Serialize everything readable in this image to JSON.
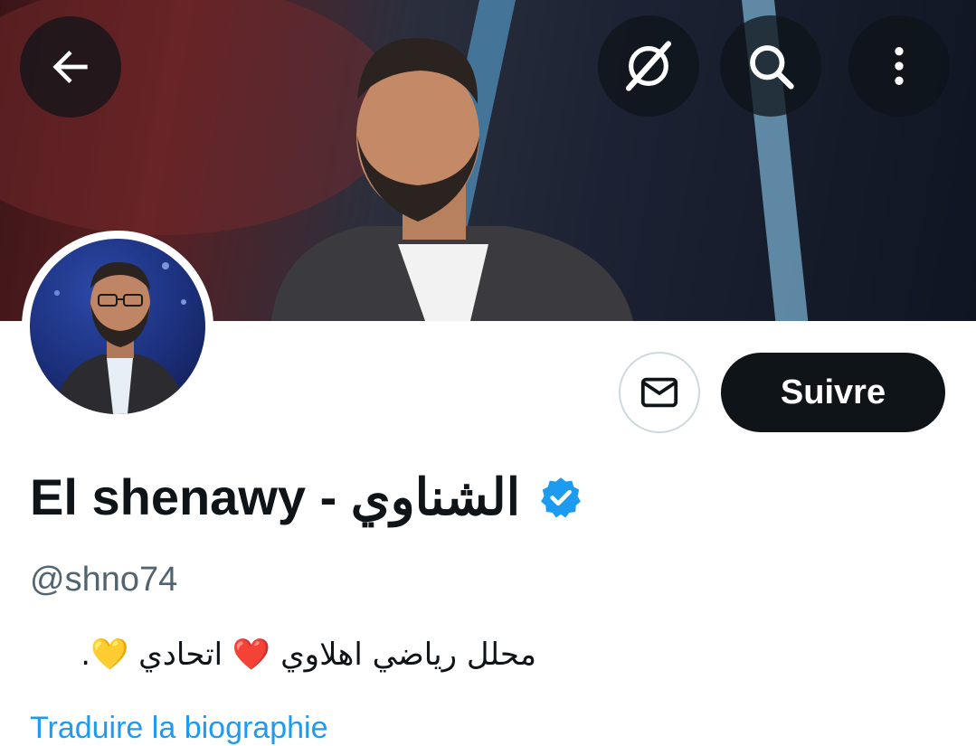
{
  "header": {
    "back_icon": "arrow-left-icon",
    "grok_icon": "grok-icon",
    "search_icon": "search-icon",
    "more_icon": "more-vertical-icon"
  },
  "profile": {
    "display_name": "El shenawy - الشناوي",
    "verified_icon": "verified-badge-icon",
    "verified_color": "#1d9bf0",
    "handle": "@shno74",
    "bio": "محلل رياضي اهلاوي ❤️ اتحادي 💛.",
    "translate_label": "Traduire la biographie"
  },
  "actions": {
    "message_icon": "envelope-icon",
    "follow_label": "Suivre"
  },
  "colors": {
    "text_primary": "#0f1419",
    "text_secondary": "#536471",
    "link": "#1d9bf0",
    "button_dark": "#0f1419",
    "border": "#cfd9de"
  }
}
